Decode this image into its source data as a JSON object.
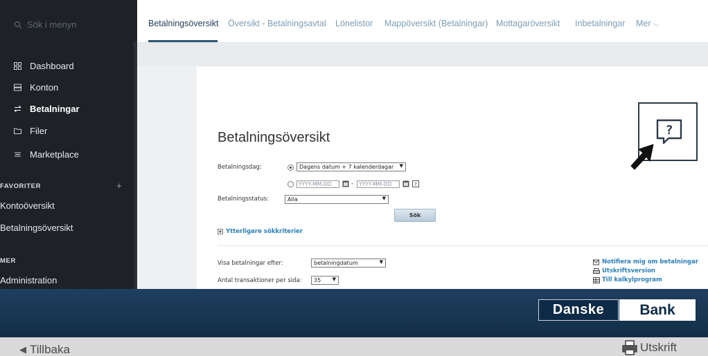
{
  "sidebar": {
    "search_placeholder": "Sök i menyn",
    "items": [
      {
        "label": "Dashboard",
        "icon": "dashboard-grid-icon"
      },
      {
        "label": "Konton",
        "icon": "accounts-icon"
      },
      {
        "label": "Betalningar",
        "icon": "transfer-arrows-icon",
        "active": true
      },
      {
        "label": "Filer",
        "icon": "folder-icon"
      },
      {
        "label": "Marketplace",
        "icon": "marketplace-icon"
      }
    ],
    "favorites_heading": "FAVORITER",
    "favorites_add": "+",
    "favorites": [
      "Kontoöversikt",
      "Betalningsöversikt"
    ],
    "more_heading": "MER",
    "more_items": [
      "Administration"
    ]
  },
  "tabs": [
    {
      "label": "Betalningsöversikt",
      "active": true
    },
    {
      "label": "Översikt - Betalningsavtal"
    },
    {
      "label": "Lönelistor"
    },
    {
      "label": "Mappöversikt (Betalningar)"
    },
    {
      "label": "Mottagaröversikt"
    },
    {
      "label": "Inbetalningar"
    },
    {
      "label": "Mer"
    }
  ],
  "content": {
    "title": "Betalningsöversikt",
    "payment_day_label": "Betalningsdag:",
    "payment_day_option": "Dagens datum + 7 kalenderdagar",
    "date_from_placeholder": "YYYY-MM-DD",
    "date_sep": "-",
    "date_to_placeholder": "YYYY-MM-DD",
    "status_label": "Betalningsstatus:",
    "status_value": "Alla",
    "search_button": "Sök",
    "more_criteria": "Ytterligare sökkriterier",
    "show_after_label": "Visa betalningar efter:",
    "show_after_value": "betalningdatum",
    "per_page_label": "Antal transaktioner per sida:",
    "per_page_value": "35",
    "links": [
      {
        "label": "Notifiera mig om betalningar",
        "icon": "notify-icon"
      },
      {
        "label": "Utskriftsversion",
        "icon": "printer-icon"
      },
      {
        "label": "Till kalkylprogram",
        "icon": "spreadsheet-icon"
      }
    ]
  },
  "brand": {
    "part1": "Danske",
    "part2": "Bank"
  },
  "bottom": {
    "back_label": "Tillbaka",
    "print_label": "Utskrift"
  },
  "colors": {
    "sidebar_bg": "#1e2227",
    "brand_navy": "#0d2a46",
    "link_blue": "#2c7fb8",
    "tab_active": "#1f3d56"
  }
}
